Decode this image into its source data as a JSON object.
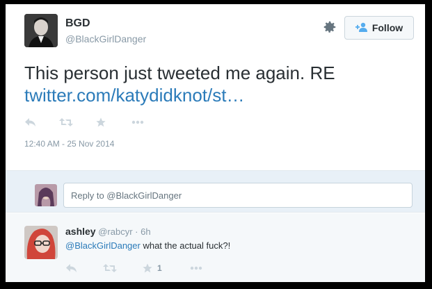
{
  "tweet": {
    "display_name": "BGD",
    "handle": "@BlackGirlDanger",
    "follow_label": "Follow",
    "text": "This person just tweeted me again. RE",
    "link": "twitter.com/katydidknot/st…",
    "timestamp": "12:40 AM - 25 Nov 2014"
  },
  "reply_box": {
    "placeholder": "Reply to @BlackGirlDanger"
  },
  "reply": {
    "name": "ashley",
    "handle": "@rabcyr",
    "dot": "·",
    "age": "6h",
    "mention": "@BlackGirlDanger",
    "text": " what the actual fuck?!",
    "favorite_count": "1"
  },
  "colors": {
    "link": "#2b7bb9",
    "text": "#292f33",
    "muted": "#8899a6",
    "icon": "#ccd6dd",
    "reply_bg": "#e8f0f7"
  },
  "icons": [
    "settings-gear-icon",
    "add-user-icon",
    "reply-icon",
    "retweet-icon",
    "favorite-star-icon",
    "more-icon"
  ]
}
